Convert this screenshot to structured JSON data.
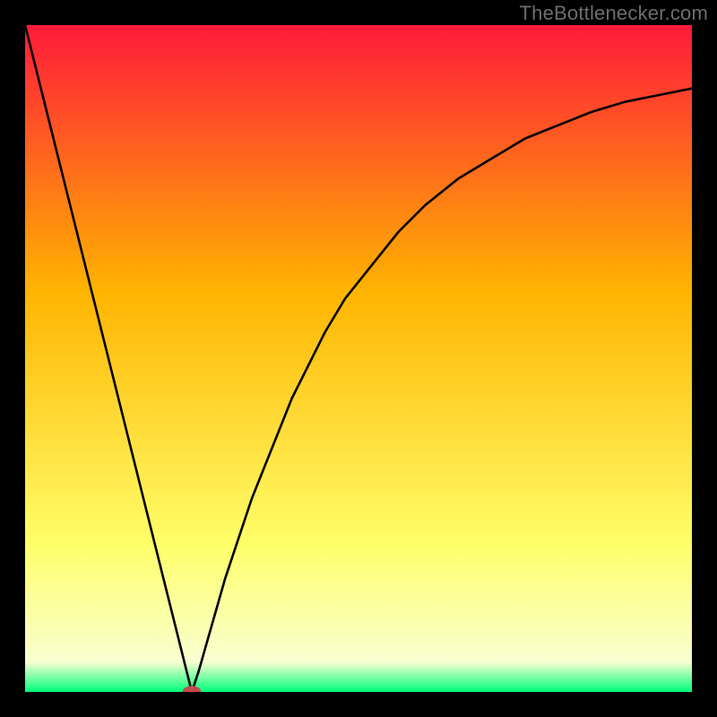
{
  "attribution": "TheBottlenecker.com",
  "colors": {
    "frame": "#000000",
    "gradient_top": "#ff1a3a",
    "gradient_mid": "#ffb400",
    "gradient_yellow": "#ffff6a",
    "gradient_pale": "#f8ffd0",
    "gradient_bottom": "#00ff7a",
    "curve": "#000000",
    "marker": "#c24a4f"
  },
  "chart_data": {
    "type": "line",
    "title": "",
    "xlabel": "",
    "ylabel": "",
    "xlim": [
      0,
      100
    ],
    "ylim": [
      0,
      100
    ],
    "grid": false,
    "legend": false,
    "x": [
      0,
      2,
      4,
      6,
      8,
      10,
      12,
      14,
      16,
      18,
      20,
      22,
      24,
      25,
      26,
      28,
      30,
      32,
      34,
      36,
      38,
      40,
      42,
      45,
      48,
      52,
      56,
      60,
      65,
      70,
      75,
      80,
      85,
      90,
      95,
      100
    ],
    "values": [
      100,
      92,
      84,
      76,
      68,
      60,
      52,
      44,
      36,
      28,
      20,
      12,
      4,
      0,
      3,
      10,
      17,
      23,
      29,
      34,
      39,
      44,
      48,
      54,
      59,
      64,
      69,
      73,
      77,
      80,
      83,
      85,
      87,
      88.5,
      89.5,
      90.5
    ],
    "minimum": {
      "x": 25,
      "y": 0
    },
    "marker": {
      "x": 25,
      "y": 0,
      "rx": 1.4,
      "ry": 0.9
    },
    "background_gradient_stops": [
      {
        "offset": 0,
        "value": 100
      },
      {
        "offset": 0.4,
        "value": 60
      },
      {
        "offset": 0.78,
        "value": 22
      },
      {
        "offset": 0.9,
        "value": 10
      },
      {
        "offset": 0.955,
        "value": 4.5
      },
      {
        "offset": 0.985,
        "value": 1.5
      },
      {
        "offset": 1.0,
        "value": 0
      }
    ]
  }
}
